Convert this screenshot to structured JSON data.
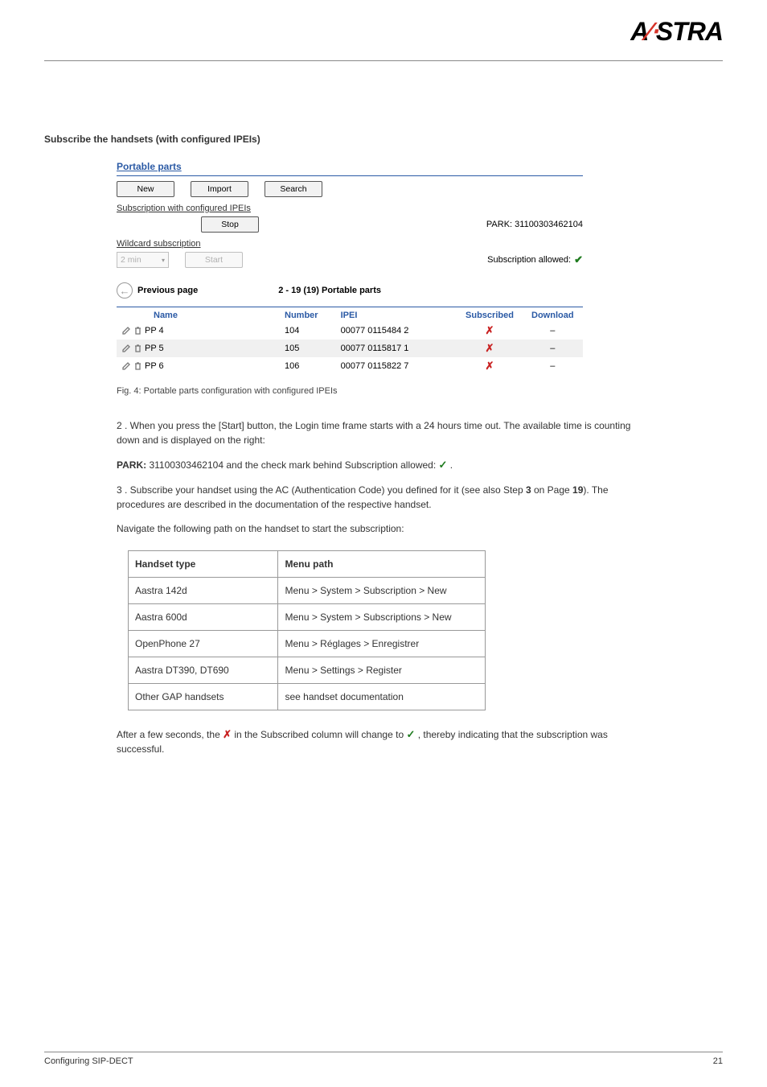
{
  "logo": {
    "text_a": "A",
    "text_axe": "∕⋅",
    "text_stra": "STRA"
  },
  "doc": {
    "heading": "Subscribe the handsets (with configured IPEIs)",
    "caption": "Fig. 4: Portable parts configuration with configured IPEIs",
    "para1": "2 . When you press the [Start] button, the Login time frame starts with a 24 hours time out. The available time is counting down and is displayed on the right:",
    "para2_label": "PARK: ",
    "para2_rest": " and the check mark behind Subscription allowed: ",
    "para2_end": ".",
    "para3_prefix": "3 . Subscribe your handset using the AC (Authentication Code) you defined for it (see also Step ",
    "para3_step": "3",
    "para3_mid": " on Page ",
    "para3_page": "19",
    "para3_suffix": "). The procedures are described in the documentation of the respective handset.",
    "para4": "Navigate the following path on the handset to start the subscription:",
    "table": {
      "col1": "Handset type",
      "col2": "Menu path",
      "rows": [
        {
          "handset": "Aastra 142d",
          "menu": "Menu > System > Subscription > New"
        },
        {
          "handset": "Aastra 600d",
          "menu": "Menu > System > Subscriptions > New"
        },
        {
          "handset": "OpenPhone 27",
          "menu": "Menu > Réglages > Enregistrer"
        },
        {
          "handset": "Aastra DT390, DT690",
          "menu": "Menu > Settings > Register"
        },
        {
          "handset": "Other GAP handsets",
          "menu": "see handset documentation"
        }
      ]
    },
    "para5_prefix": "After a few seconds, the ",
    "para5_cross": "✗",
    "para5_mid": " in the Subscribed column will change to ",
    "para5_check": "✓",
    "para5_suffix": ", thereby indicating that the subscription was successful."
  },
  "screenshot": {
    "title": "Portable parts",
    "buttons": {
      "new": "New",
      "import": "Import",
      "search": "Search"
    },
    "section1": "Subscription with configured IPEIs",
    "stop": "Stop",
    "park_label": "PARK: ",
    "park_value": "31100303462104",
    "section2": "Wildcard subscription",
    "duration": "2 min",
    "start": "Start",
    "sub_allowed": "Subscription allowed: ",
    "prev": "Previous page",
    "range": "2 - 19 (19) Portable parts",
    "headers": {
      "name": "Name",
      "number": "Number",
      "ipei": "IPEI",
      "subscribed": "Subscribed",
      "download": "Download"
    },
    "rows": [
      {
        "name": "PP 4",
        "number": "104",
        "ipei": "00077 0115484 2",
        "download": "–"
      },
      {
        "name": "PP 5",
        "number": "105",
        "ipei": "00077 0115817 1",
        "download": "–"
      },
      {
        "name": "PP 6",
        "number": "106",
        "ipei": "00077 0115822 7",
        "download": "–"
      }
    ]
  },
  "footer": {
    "left": "Configuring SIP-DECT",
    "right": "21"
  }
}
